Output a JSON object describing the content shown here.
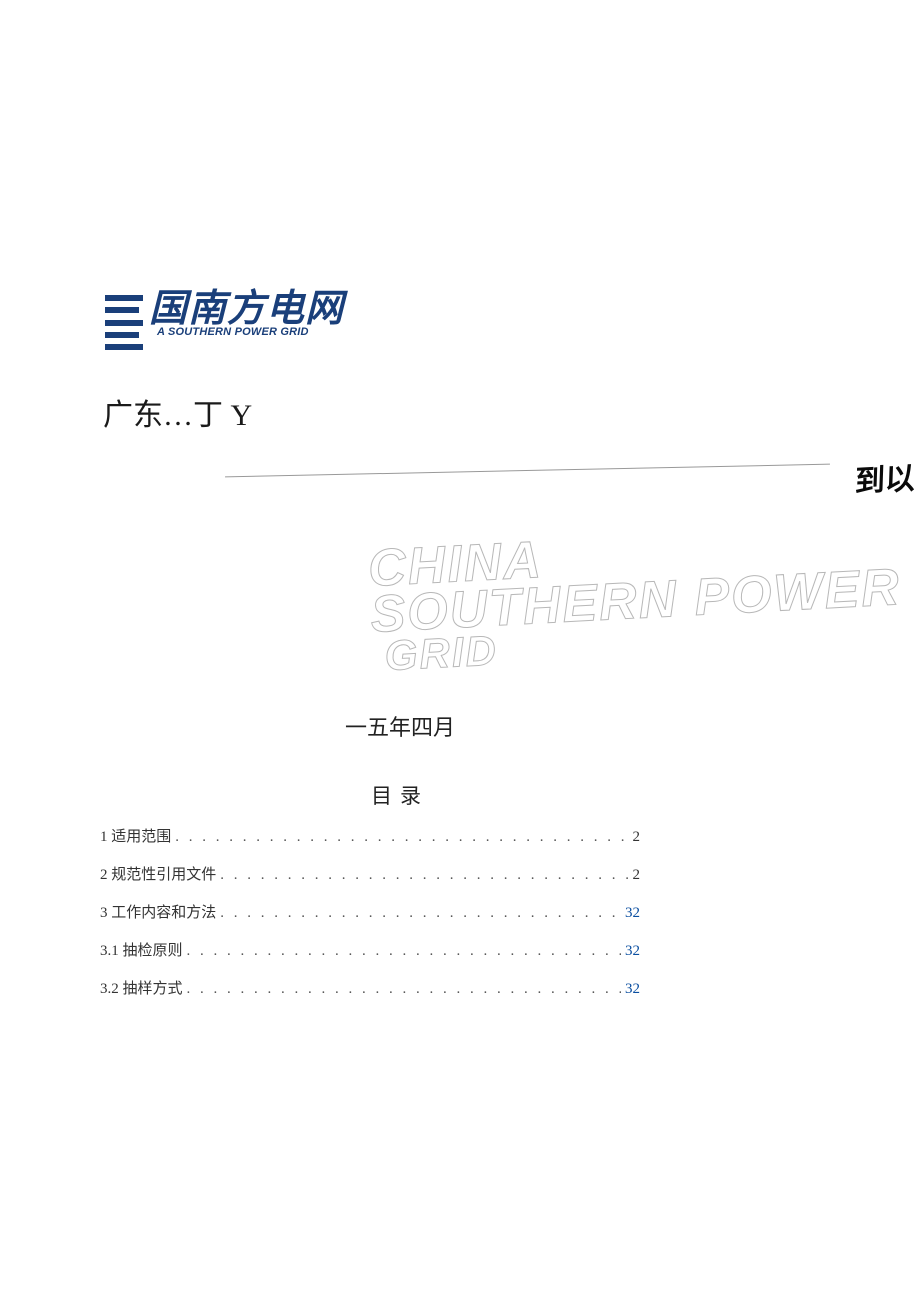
{
  "logo": {
    "cn_fragment": "国南方电网",
    "en_fragment": "A SOUTHERN POWER GRID"
  },
  "subtitle_fragment": "广东…丁 Y",
  "cutoff_fragment": "到以",
  "watermark": {
    "line1": "CHINA",
    "line2": "SOUTHERN POWER",
    "line3": "GRID"
  },
  "date_line": "一五年四月",
  "toc_heading": "目录",
  "toc": [
    {
      "label": "1 适用范围",
      "page": "2",
      "link": false
    },
    {
      "label": "2 规范性引用文件",
      "page": "2",
      "link": false
    },
    {
      "label": "3 工作内容和方法",
      "page": "32",
      "link": true
    },
    {
      "label": "3.1 抽检原则",
      "page": "32",
      "link": true
    },
    {
      "label": "3.2 抽样方式",
      "page": "32",
      "link": true
    }
  ]
}
